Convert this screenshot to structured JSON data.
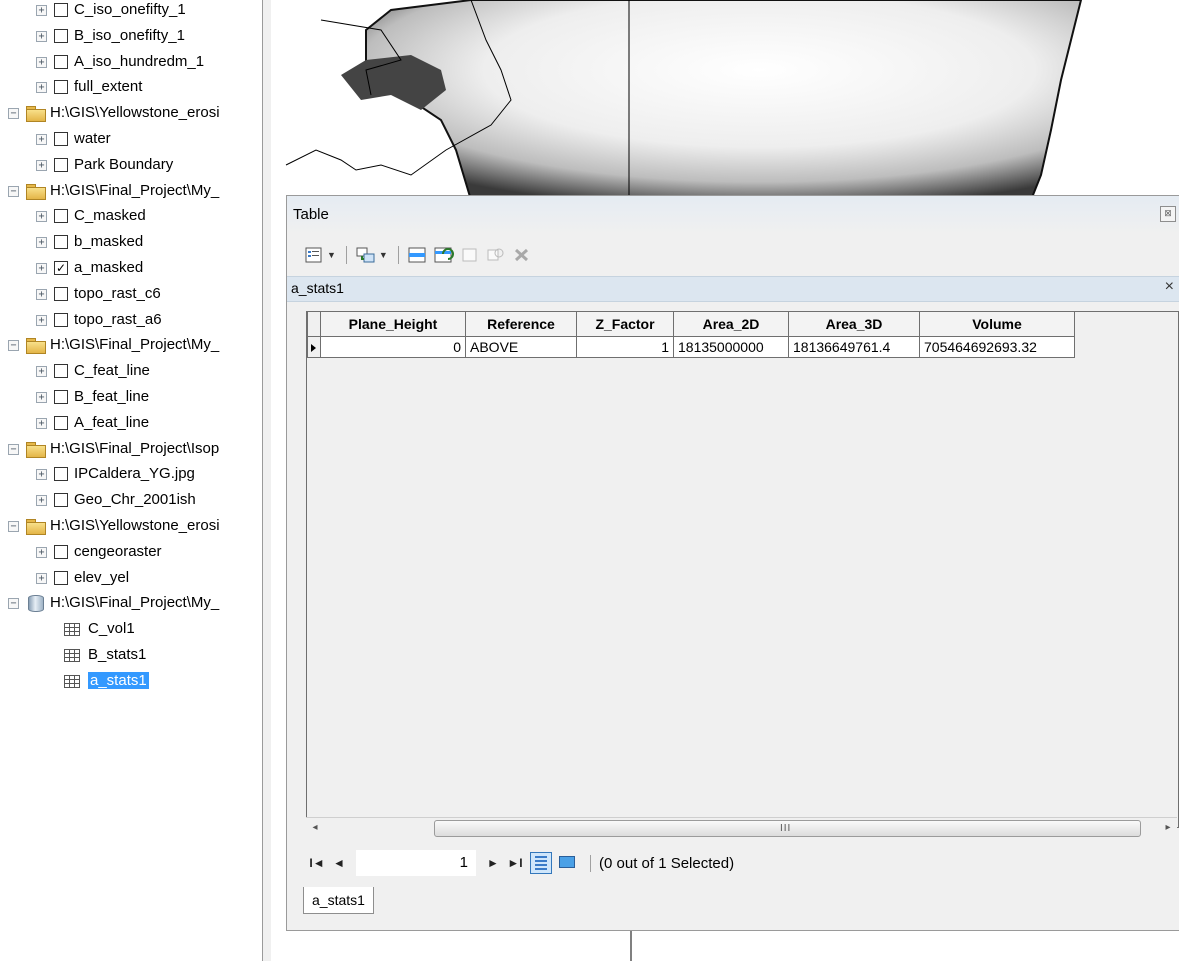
{
  "toc": {
    "rows": [
      {
        "kind": "layer",
        "label": "C_iso_onefifty_1",
        "checked": false
      },
      {
        "kind": "layer",
        "label": "B_iso_onefifty_1",
        "checked": false
      },
      {
        "kind": "layer",
        "label": "A_iso_hundredm_1",
        "checked": false
      },
      {
        "kind": "layer",
        "label": "full_extent",
        "checked": false
      },
      {
        "kind": "group",
        "label": "H:\\GIS\\Yellowstone_erosi",
        "icon": "folder-icon"
      },
      {
        "kind": "layer",
        "label": "water",
        "checked": false
      },
      {
        "kind": "layer",
        "label": "Park Boundary",
        "checked": false
      },
      {
        "kind": "group",
        "label": "H:\\GIS\\Final_Project\\My_",
        "icon": "folder-icon"
      },
      {
        "kind": "layer",
        "label": "C_masked",
        "checked": false
      },
      {
        "kind": "layer",
        "label": "b_masked",
        "checked": false
      },
      {
        "kind": "layer",
        "label": "a_masked",
        "checked": true
      },
      {
        "kind": "layer",
        "label": "topo_rast_c6",
        "checked": false
      },
      {
        "kind": "layer",
        "label": "topo_rast_a6",
        "checked": false
      },
      {
        "kind": "group",
        "label": "H:\\GIS\\Final_Project\\My_",
        "icon": "folder-icon"
      },
      {
        "kind": "layer",
        "label": "C_feat_line",
        "checked": false
      },
      {
        "kind": "layer",
        "label": "B_feat_line",
        "checked": false
      },
      {
        "kind": "layer",
        "label": "A_feat_line",
        "checked": false
      },
      {
        "kind": "group",
        "label": "H:\\GIS\\Final_Project\\Isop",
        "icon": "folder-icon"
      },
      {
        "kind": "layer",
        "label": "IPCaldera_YG.jpg",
        "checked": false
      },
      {
        "kind": "layer",
        "label": "Geo_Chr_2001ish",
        "checked": false
      },
      {
        "kind": "group",
        "label": "H:\\GIS\\Yellowstone_erosi",
        "icon": "folder-icon"
      },
      {
        "kind": "layer",
        "label": "cengeoraster",
        "checked": false
      },
      {
        "kind": "layer",
        "label": "elev_yel",
        "checked": false
      },
      {
        "kind": "group",
        "label": "H:\\GIS\\Final_Project\\My_",
        "icon": "database-icon"
      },
      {
        "kind": "table",
        "label": "C_vol1",
        "selected": false
      },
      {
        "kind": "table",
        "label": "B_stats1",
        "selected": false
      },
      {
        "kind": "table",
        "label": "a_stats1",
        "selected": true
      }
    ]
  },
  "table_window": {
    "title": "Table",
    "close_glyph": "⊠",
    "tab_name": "a_stats1",
    "tab_close": "×",
    "columns": [
      "Plane_Height",
      "Reference",
      "Z_Factor",
      "Area_2D",
      "Area_3D",
      "Volume"
    ],
    "rows": [
      [
        "0",
        "ABOVE",
        "1",
        "18135000000",
        "18136649761.4",
        "705464692693.32"
      ]
    ],
    "scroll_grip": "III",
    "nav": {
      "first": "I◄",
      "prev": "◄",
      "record": "1",
      "next": "►",
      "last": "►I",
      "status": "(0 out of 1 Selected)"
    },
    "bottom_tab": "a_stats1"
  },
  "colors": {
    "selection": "#3399ff",
    "tabbar": "#dce6f0"
  }
}
